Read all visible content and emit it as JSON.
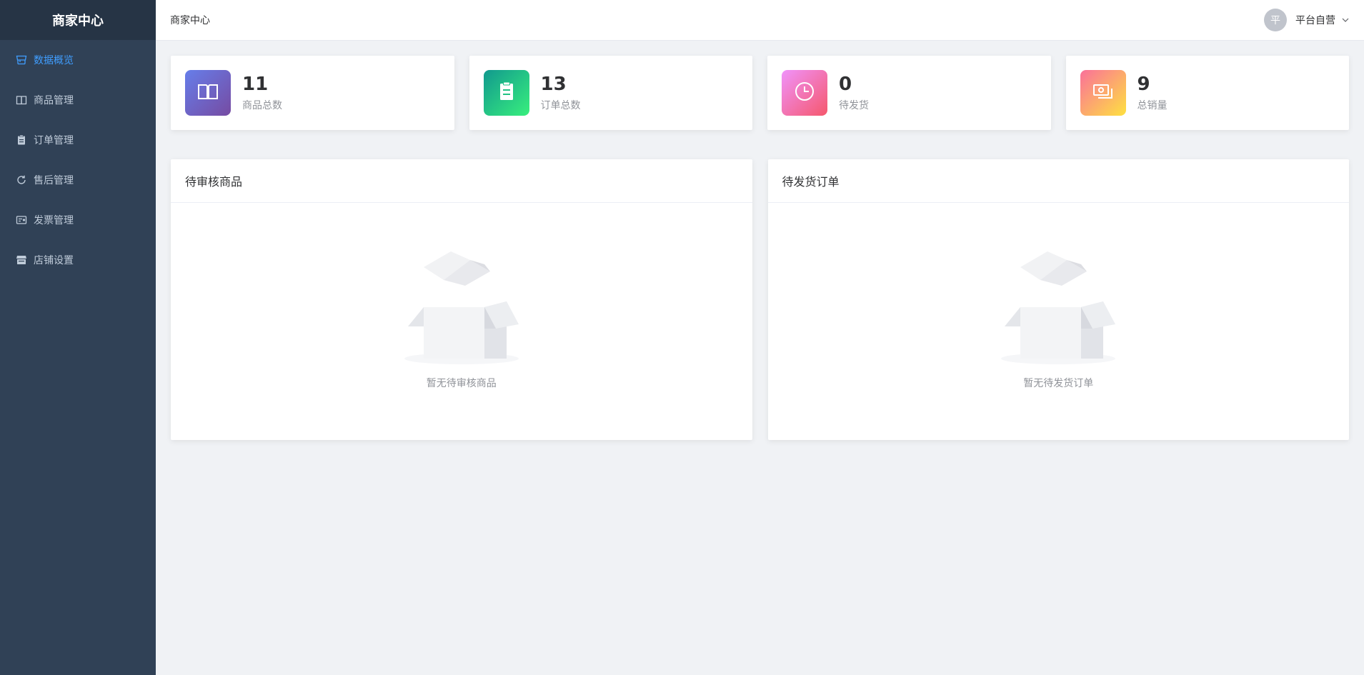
{
  "sidebar": {
    "title": "商家中心",
    "items": [
      {
        "label": "数据概览",
        "icon": "storefront-icon",
        "active": true
      },
      {
        "label": "商品管理",
        "icon": "book-icon",
        "active": false
      },
      {
        "label": "订单管理",
        "icon": "clipboard-icon",
        "active": false
      },
      {
        "label": "售后管理",
        "icon": "refresh-icon",
        "active": false
      },
      {
        "label": "发票管理",
        "icon": "invoice-icon",
        "active": false
      },
      {
        "label": "店铺设置",
        "icon": "shop-icon",
        "active": false
      }
    ]
  },
  "header": {
    "breadcrumb": "商家中心",
    "avatar_text": "平",
    "user_name": "平台自营"
  },
  "stats": [
    {
      "value": "11",
      "label": "商品总数",
      "icon": "book-icon",
      "gradient": [
        "#667eea",
        "#764ba2"
      ]
    },
    {
      "value": "13",
      "label": "订单总数",
      "icon": "clipboard-icon",
      "gradient": [
        "#11998e",
        "#38ef7d"
      ]
    },
    {
      "value": "0",
      "label": "待发货",
      "icon": "clock-icon",
      "gradient": [
        "#f093fb",
        "#f5576c"
      ]
    },
    {
      "value": "9",
      "label": "总销量",
      "icon": "money-icon",
      "gradient": [
        "#fa709a",
        "#fee140"
      ]
    }
  ],
  "panels": [
    {
      "title": "待审核商品",
      "empty_text": "暂无待审核商品"
    },
    {
      "title": "待发货订单",
      "empty_text": "暂无待发货订单"
    }
  ],
  "colors": {
    "sidebar_bg": "#304156",
    "sidebar_logo_bg": "#263445",
    "active": "#409eff",
    "page_bg": "#f0f2f5"
  }
}
